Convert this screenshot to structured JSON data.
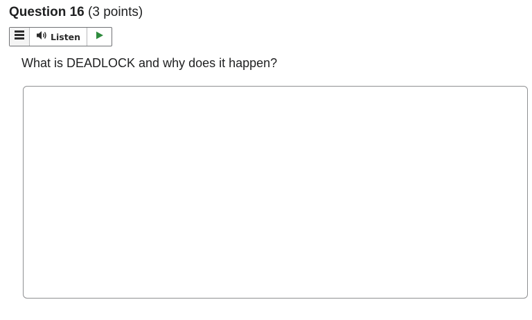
{
  "question": {
    "title": "Question 16",
    "points": "(3 points)",
    "prompt": "What is DEADLOCK and why does it happen?"
  },
  "toolbar": {
    "menu_icon": "menu-icon",
    "speaker_icon": "speaker-icon",
    "listen_label": "Listen",
    "play_icon": "play-icon",
    "play_color": "#2e8b3d"
  },
  "answer": {
    "value": "",
    "placeholder": ""
  },
  "colors": {
    "text": "#202122",
    "border": "#8e8f91"
  }
}
